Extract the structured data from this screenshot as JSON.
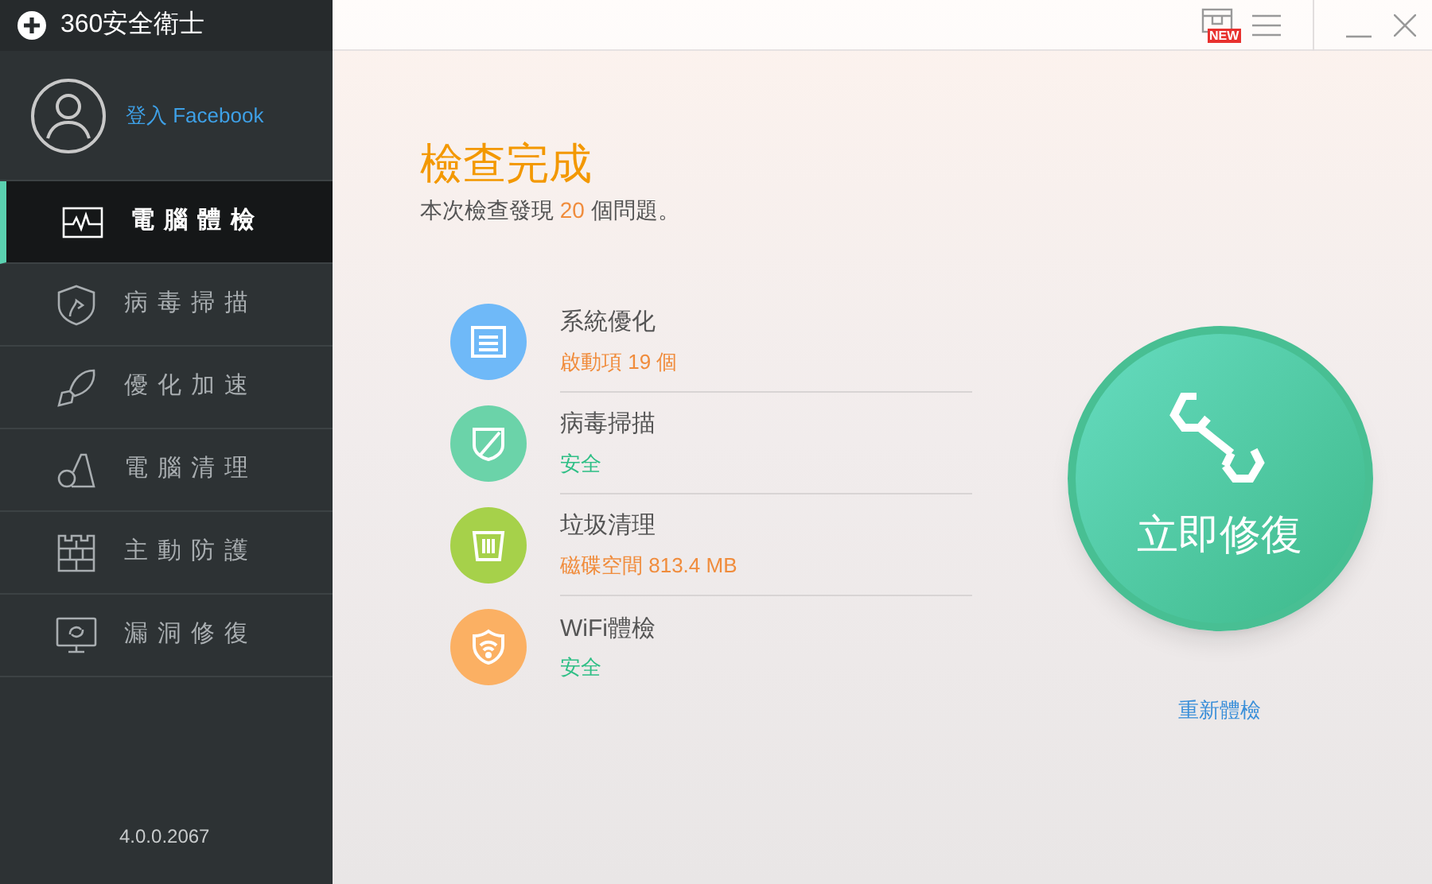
{
  "app": {
    "title": "360安全衛士",
    "version": "4.0.0.2067"
  },
  "profile": {
    "login_link": "登入 Facebook"
  },
  "sidebar": {
    "items": [
      {
        "label": "電腦體檢",
        "kind": "checkup",
        "selected": true
      },
      {
        "label": "病毒掃描",
        "kind": "virus",
        "selected": false
      },
      {
        "label": "優化加速",
        "kind": "speed",
        "selected": false
      },
      {
        "label": "電腦清理",
        "kind": "clean",
        "selected": false
      },
      {
        "label": "主動防護",
        "kind": "firewall",
        "selected": false
      },
      {
        "label": "漏洞修復",
        "kind": "patch",
        "selected": false
      }
    ]
  },
  "toolbar": {
    "badge": "NEW"
  },
  "result": {
    "title": "檢查完成",
    "summary_before": "本次檢查發現",
    "count": "20",
    "summary_after": "個問題。"
  },
  "checks": [
    {
      "name": "系統優化",
      "detail": "啟動項 19 個",
      "kind": "optimize",
      "warning": true,
      "color": "#6fb9f8"
    },
    {
      "name": "病毒掃描",
      "detail": "安全",
      "kind": "virus",
      "warning": false,
      "color": "#6bd3a9"
    },
    {
      "name": "垃圾清理",
      "detail": "磁碟空間 813.4 MB",
      "kind": "trash",
      "warning": true,
      "color": "#a6d14a"
    },
    {
      "name": "WiFi體檢",
      "detail": "安全",
      "kind": "wifi",
      "warning": false,
      "color": "#fbb063"
    }
  ],
  "fix_button": {
    "label": "立即修復"
  },
  "rescan_link": "重新體檢"
}
